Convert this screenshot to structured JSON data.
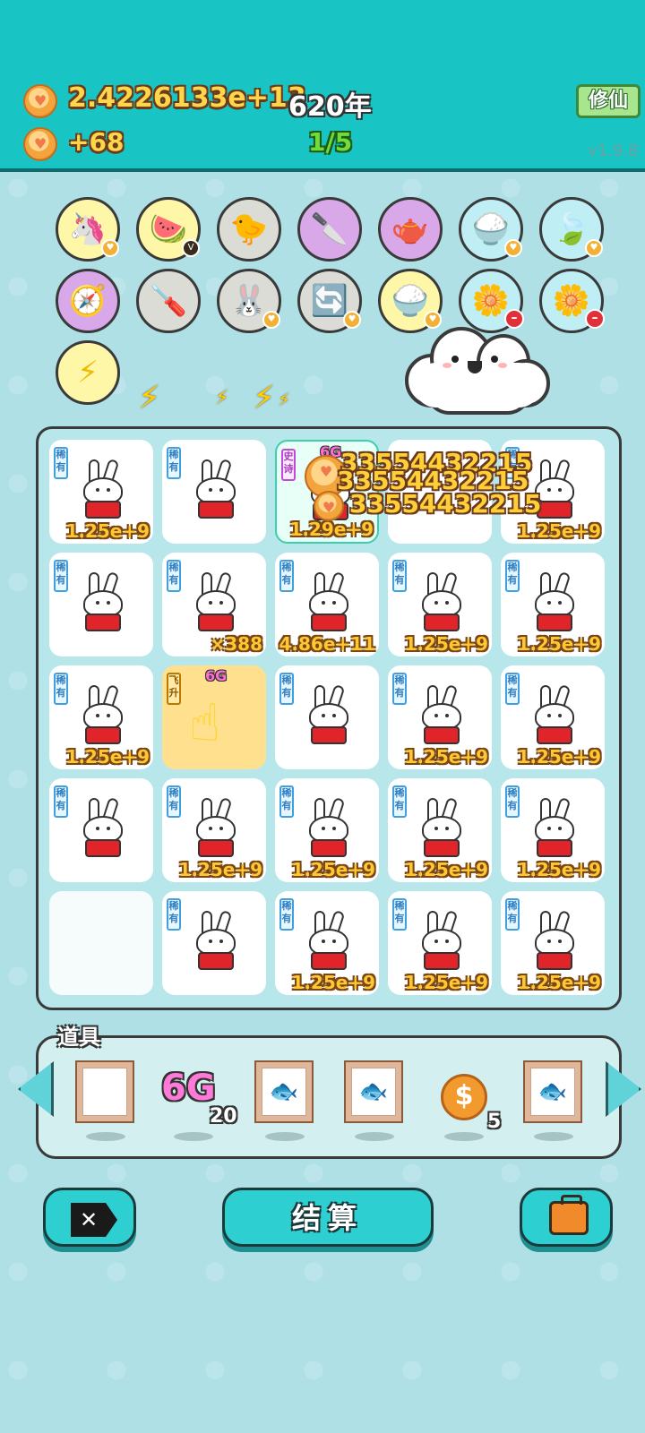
{
  "header": {
    "gold_total": "2.4226133e+13",
    "years": "620年",
    "gold_rate": "+68",
    "progress": "1/5",
    "xiuxian_label": "修仙",
    "version": "v1.9.8"
  },
  "skills_row1": [
    "unicorn-icon",
    "fruit-basket-icon",
    "chick-icon",
    "cleaver-icon",
    "gravy-boat-icon",
    "rice-bowl-icon",
    "leaf-icon"
  ],
  "skills_row2": [
    "compass-icon",
    "screwdriver-icon",
    "bunny-icon",
    "refresh-icon",
    "rice-bowl-icon",
    "flower-pot-icon",
    "flower-pot-icon"
  ],
  "skills_row3": [
    "lightning-icon"
  ],
  "skill_fruit_badge": "V",
  "grid": {
    "rows": [
      [
        {
          "tag": "稀有",
          "value": "1.25e+9"
        },
        {
          "tag": "稀有",
          "value": ""
        },
        {
          "tag": "史诗",
          "value": "1.29e+9",
          "badge": "6G"
        },
        {
          "tag": "",
          "value": ""
        },
        {
          "tag": "稀有",
          "value": "1.25e+9"
        }
      ],
      [
        {
          "tag": "稀有",
          "value": ""
        },
        {
          "tag": "稀有",
          "value": "×388"
        },
        {
          "tag": "稀有",
          "value": "4.86e+11"
        },
        {
          "tag": "稀有",
          "value": "1.25e+9"
        },
        {
          "tag": "稀有",
          "value": "1.25e+9"
        }
      ],
      [
        {
          "tag": "稀有",
          "value": "1.25e+9"
        },
        {
          "tag": "飞升",
          "value": "",
          "badge": "6G"
        },
        {
          "tag": "稀有",
          "value": ""
        },
        {
          "tag": "稀有",
          "value": "1.25e+9"
        },
        {
          "tag": "稀有",
          "value": "1.25e+9"
        }
      ],
      [
        {
          "tag": "稀有",
          "value": ""
        },
        {
          "tag": "稀有",
          "value": "1.25e+9"
        },
        {
          "tag": "稀有",
          "value": "1.25e+9"
        },
        {
          "tag": "稀有",
          "value": "1.25e+9"
        },
        {
          "tag": "稀有",
          "value": "1.25e+9"
        }
      ],
      [
        {
          "tag": "",
          "value": ""
        },
        {
          "tag": "稀有",
          "value": ""
        },
        {
          "tag": "稀有",
          "value": "1.25e+9"
        },
        {
          "tag": "稀有",
          "value": "1.25e+9"
        },
        {
          "tag": "稀有",
          "value": "1.25e+9"
        }
      ]
    ],
    "floating": [
      "33554432215",
      "33554432215",
      "33554432215"
    ]
  },
  "items": {
    "label": "道具",
    "g6_label": "6G",
    "g6_count": "20",
    "coin_symbol": "$",
    "coin_count": "5"
  },
  "buttons": {
    "settle_label": "结算"
  }
}
